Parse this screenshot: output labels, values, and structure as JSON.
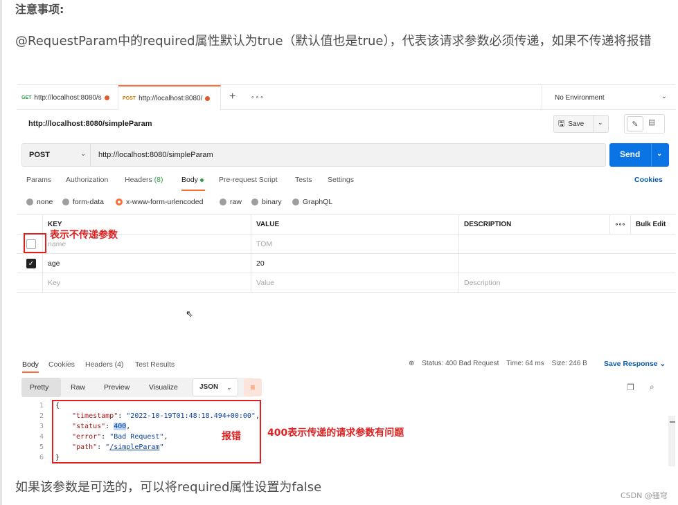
{
  "article": {
    "heading": "注意事项:",
    "paragraph1": "@RequestParam中的required属性默认为true（默认值也是true），代表该请求参数必须传递，如果不传递将报错",
    "paragraph2": "如果该参数是可选的，可以将required属性设置为false",
    "watermark": "CSDN @骚穹"
  },
  "tabs": [
    {
      "method": "GET",
      "title": "http://localhost:8080/s",
      "method_color": "#2e9e47"
    },
    {
      "method": "POST",
      "title": "http://localhost:8080/",
      "method_color": "#d97a00"
    }
  ],
  "tabbar": {
    "plus": "+",
    "more": "∘∘∘"
  },
  "environment": {
    "label": "No Environment"
  },
  "request": {
    "title": "http://localhost:8080/simpleParam",
    "save_label": "Save",
    "method": "POST",
    "url": "http://localhost:8080/simpleParam",
    "send_label": "Send"
  },
  "subtabs": {
    "params": "Params",
    "authorization": "Authorization",
    "headers": "Headers",
    "headers_count": "(8)",
    "body": "Body",
    "prerequest": "Pre-request Script",
    "tests": "Tests",
    "settings": "Settings",
    "cookies": "Cookies"
  },
  "body_types": [
    "none",
    "form-data",
    "x-www-form-urlencoded",
    "raw",
    "binary",
    "GraphQL"
  ],
  "params_table": {
    "headers": {
      "key": "KEY",
      "value": "VALUE",
      "description": "DESCRIPTION",
      "more": "∘∘∘",
      "bulk_edit": "Bulk Edit"
    },
    "rows": [
      {
        "key": "name",
        "value": "TOM",
        "checked": false
      },
      {
        "key": "age",
        "value": "20",
        "checked": true
      }
    ],
    "placeholder": {
      "key": "Key",
      "value": "Value",
      "description": "Description"
    }
  },
  "annotations": {
    "not_sent": "表示不传递参数",
    "error": "报错",
    "status_400": "400表示传递的请求参数有问题"
  },
  "response": {
    "tabs": {
      "body": "Body",
      "cookies": "Cookies",
      "headers": "Headers (4)",
      "test_results": "Test Results"
    },
    "status_label": "Status:",
    "status_value": "400 Bad Request",
    "time_label": "Time:",
    "time_value": "64 ms",
    "size_label": "Size:",
    "size_value": "246 B",
    "save_response": "Save Response",
    "views": [
      "Pretty",
      "Raw",
      "Preview",
      "Visualize"
    ],
    "format": "JSON",
    "code": {
      "l1": "{",
      "timestamp_key": "\"timestamp\"",
      "timestamp_val": "\"2022-10-19T01:48:18.494+00:00\"",
      "status_key": "\"status\"",
      "status_val": "400",
      "error_key": "\"error\"",
      "error_val": "\"Bad Request\"",
      "path_key": "\"path\"",
      "path_val": "/simpleParam",
      "l6": "}"
    },
    "line_numbers": [
      "1",
      "2",
      "3",
      "4",
      "5",
      "6"
    ]
  },
  "colors": {
    "accent": "#ff6c37",
    "send_blue": "#0b74e5",
    "annotation_red": "#e02020"
  }
}
